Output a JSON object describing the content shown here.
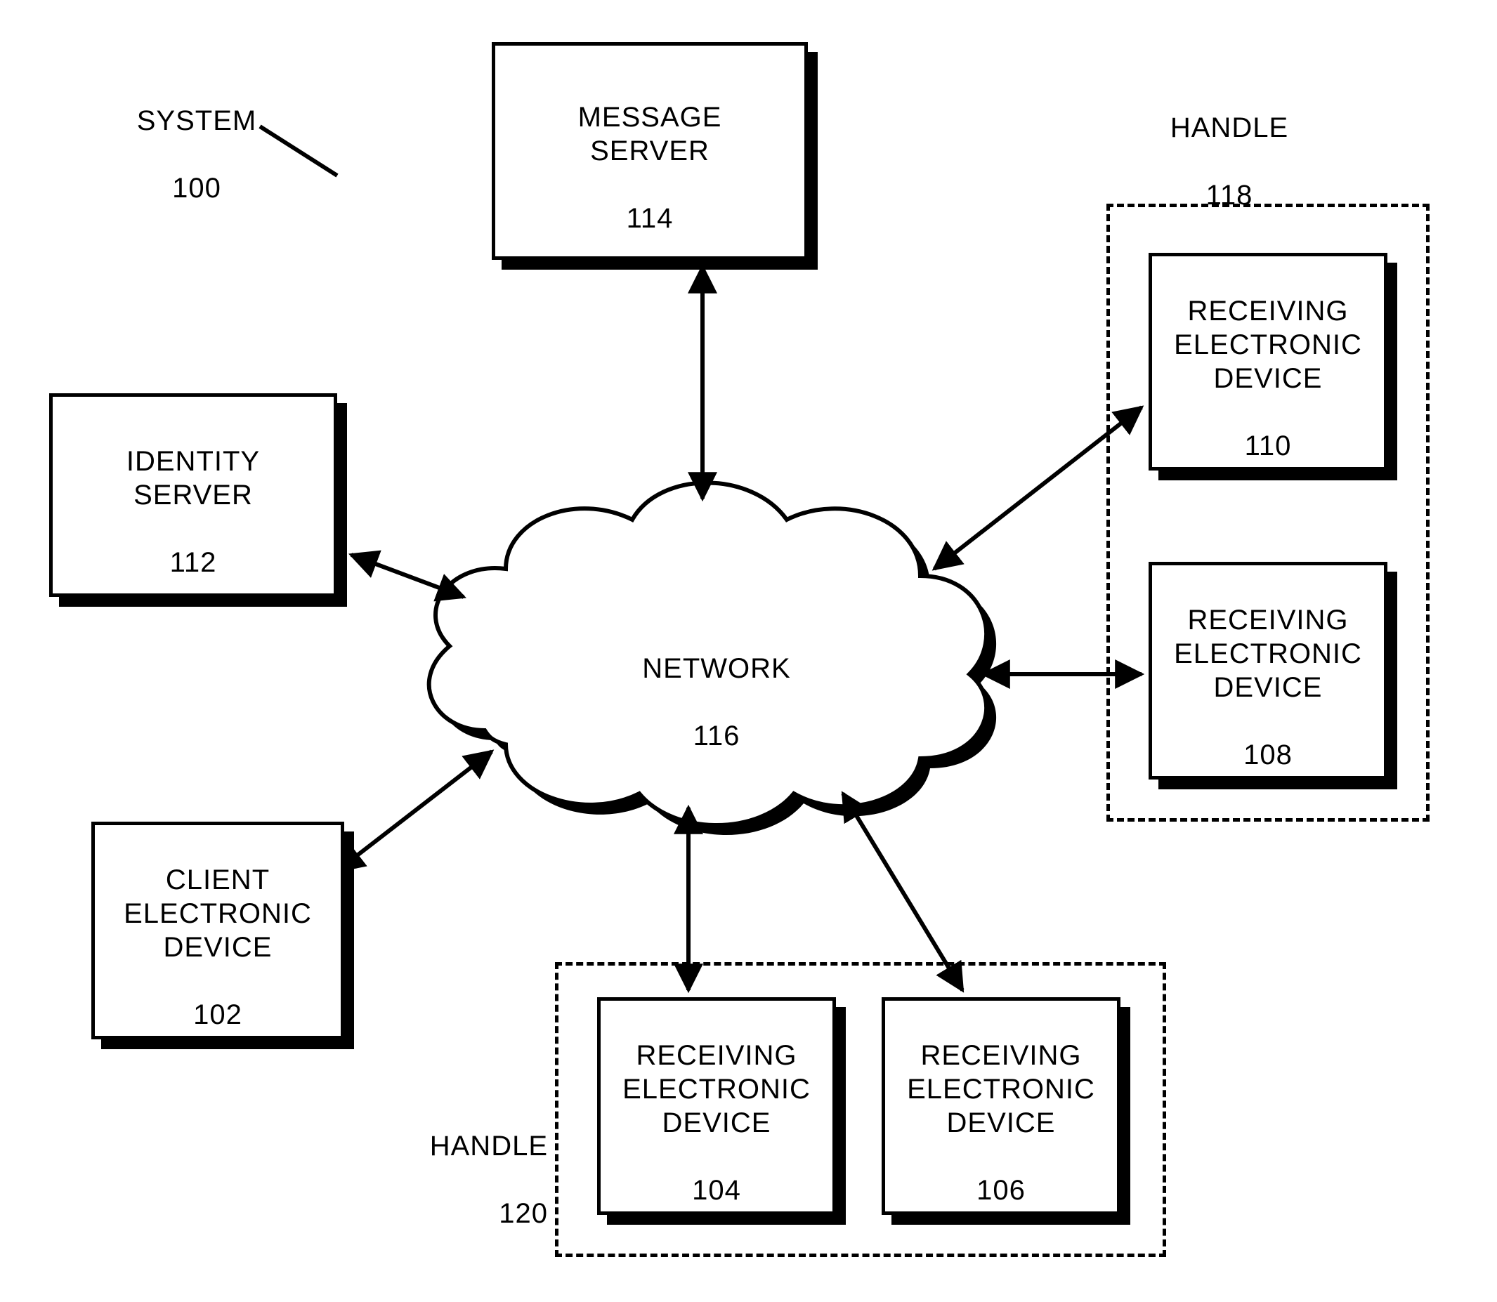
{
  "legend_system": {
    "title": "SYSTEM",
    "ref": "100"
  },
  "boxes": {
    "message_server": {
      "title": "MESSAGE\nSERVER",
      "ref": "114"
    },
    "identity_server": {
      "title": "IDENTITY\nSERVER",
      "ref": "112"
    },
    "client_device": {
      "title": "CLIENT\nELECTRONIC\nDEVICE",
      "ref": "102"
    },
    "recv_104": {
      "title": "RECEIVING\nELECTRONIC\nDEVICE",
      "ref": "104"
    },
    "recv_106": {
      "title": "RECEIVING\nELECTRONIC\nDEVICE",
      "ref": "106"
    },
    "recv_108": {
      "title": "RECEIVING\nELECTRONIC\nDEVICE",
      "ref": "108"
    },
    "recv_110": {
      "title": "RECEIVING\nELECTRONIC\nDEVICE",
      "ref": "110"
    }
  },
  "network": {
    "title": "NETWORK",
    "ref": "116"
  },
  "handles": {
    "h118": {
      "title": "HANDLE",
      "ref": "118"
    },
    "h120": {
      "title": "HANDLE",
      "ref": "120"
    }
  }
}
